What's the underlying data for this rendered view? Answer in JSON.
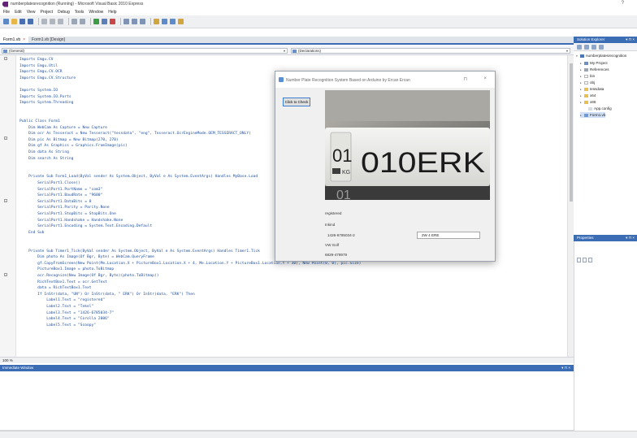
{
  "window": {
    "title": "numberplatesrecognition (Running) - Microsoft Visual Basic 2010 Express",
    "help_glyph": "?"
  },
  "menu": {
    "items": [
      "File",
      "Edit",
      "View",
      "Project",
      "Debug",
      "Tools",
      "Window",
      "Help"
    ]
  },
  "tabs": [
    {
      "label": "Form1.vb",
      "close": "×"
    },
    {
      "label": "Form1.vb [Design]"
    }
  ],
  "member_bar": {
    "left": "(General)",
    "right": "(Declarations)"
  },
  "code": {
    "lines": [
      "Imports Emgu.CV",
      "Imports Emgu.Util",
      "Imports Emgu.CV.OCR",
      "Imports Emgu.CV.Structure",
      "",
      "Imports System.IO",
      "Imports System.IO.Ports",
      "Imports System.Threading",
      "",
      "",
      "Public Class Form1",
      "    Dim WebCam As Capture = New Capture",
      "    Dim ocr As Tesseract = New Tesseract(\"tessdata\", \"eng\", Tesseract.OcrEngineMode.OEM_TESSERACT_ONLY)",
      "    Dim pic As Bitmap = New Bitmap(270, 270)",
      "    Dim gf As Graphics = Graphics.FromImage(pic)",
      "    Dim data As String",
      "    Dim search As String",
      "",
      "",
      "    Private Sub Form1_Load(ByVal sender As System.Object, ByVal e As System.EventArgs) Handles MyBase.Load",
      "        SerialPort1.Close()",
      "        SerialPort1.PortName = \"com3\"",
      "        SerialPort1.BaudRate = \"9600\"",
      "        SerialPort1.DataBits = 8",
      "        SerialPort1.Parity = Parity.None",
      "        SerialPort1.StopBits = StopBits.One",
      "        SerialPort1.Handshake = Handshake.None",
      "        SerialPort1.Encoding = System.Text.Encoding.Default",
      "    End Sub",
      "",
      "",
      "    Private Sub Timer1_Tick(ByVal sender As System.Object, ByVal e As System.EventArgs) Handles Timer1.Tick",
      "        Dim photo As Image(Of Bgr, Byte) = WebCam.QueryFrame",
      "        gf.CopyFromScreen(New Point(Me.Location.X + PictureBox1.Location.X + 4, Me.Location.Y + PictureBox1.Location.Y + 30), New Point(0, 0), pic.Size)",
      "        PictureBox1.Image = photo.ToBitmap",
      "        ocr.Recognize(New Image(Of Bgr, Byte)(photo.ToBitmap))",
      "        RichTextBox1.Text = ocr.GetText",
      "        data = RichTextBox1.Text",
      "        If InStr(data, \"UN\") Or InStr(data, \" ERK\") Or InStr(data, \"ERK\") Then",
      "            Label1.Text = \"registered\"",
      "            Label2.Text = \"Tekel\"",
      "            Label3.Text = \"1426-6785034-7\"",
      "            Label4.Text = \"Corolla 2006\"",
      "            Label5.Text = \"Scoopy\""
    ]
  },
  "zoom_label": "100 %",
  "immediate": {
    "title": "Immediate Window",
    "pin": "▾ ⊓ ×"
  },
  "solution_explorer": {
    "title": "Solution Explorer",
    "pin": "▾ ⊓ ×",
    "items": [
      {
        "label": "numberplatesrecognition",
        "expander": "▾"
      },
      {
        "label": "My Project",
        "expander": "▸"
      },
      {
        "label": "References",
        "expander": "▸"
      },
      {
        "label": "bin",
        "expander": "▸"
      },
      {
        "label": "obj",
        "expander": "▸"
      },
      {
        "label": "tessdata",
        "expander": "▸"
      },
      {
        "label": "x64",
        "expander": "▸"
      },
      {
        "label": "x86",
        "expander": "▸"
      },
      {
        "label": "App.config",
        "expander": ""
      },
      {
        "label": "Form1.vb",
        "expander": "▸"
      }
    ]
  },
  "properties": {
    "title": "Properties",
    "pin": "▾ ⊓ ×"
  },
  "app_form": {
    "title": "Number Plate Recognition System Based on Arduino by Ercan Ercan",
    "minimize": "⊓",
    "close": "×",
    "check_button": "Click to Check",
    "plate_top": "01",
    "plate_country": "KG",
    "plate_main": "010ERK",
    "plate_next": "01",
    "labels": [
      "registered",
      "Inkind",
      "1426-6785034-2",
      "VW Golf",
      "6829-478979"
    ],
    "textbox_value": "2W 4 ERE"
  }
}
